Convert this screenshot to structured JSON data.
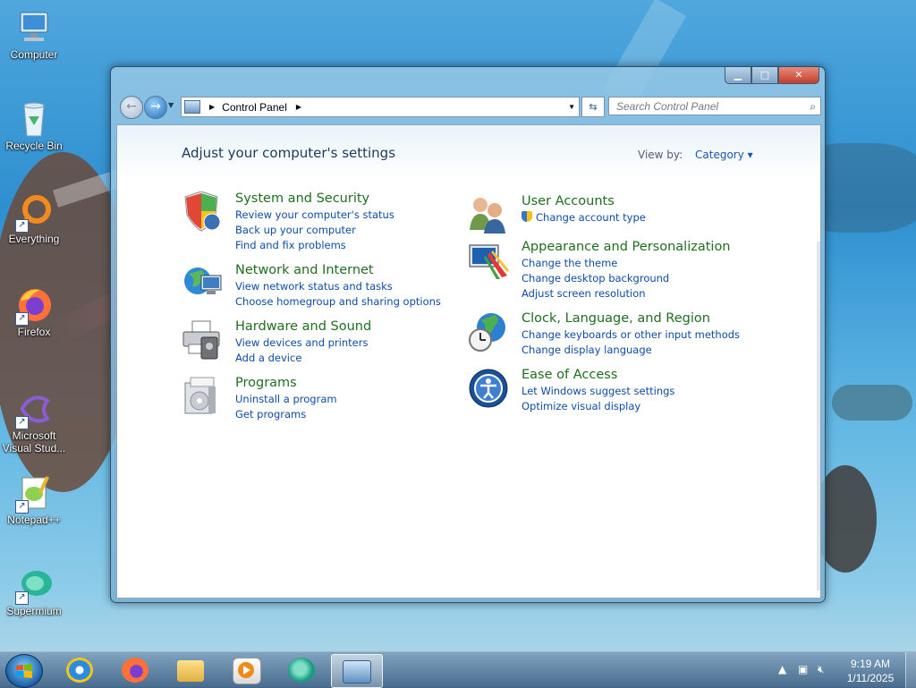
{
  "desktop": {
    "icons": [
      {
        "label": "Computer"
      },
      {
        "label": "Recycle Bin"
      },
      {
        "label": "Everything"
      },
      {
        "label": "Firefox"
      },
      {
        "label": "Microsoft Visual Stud..."
      },
      {
        "label": "Notepad++"
      },
      {
        "label": "Supermium"
      }
    ]
  },
  "window": {
    "address": {
      "crumb": "Control Panel",
      "icon": "control-panel-icon"
    },
    "search_placeholder": "Search Control Panel",
    "heading": "Adjust your computer's settings",
    "view_by_label": "View by:",
    "view_by_value": "Category",
    "categories_left": [
      {
        "title": "System and Security",
        "icon": "shield-icon",
        "links": [
          "Review your computer's status",
          "Back up your computer",
          "Find and fix problems"
        ]
      },
      {
        "title": "Network and Internet",
        "icon": "network-globe-icon",
        "links": [
          "View network status and tasks",
          "Choose homegroup and sharing options"
        ]
      },
      {
        "title": "Hardware and Sound",
        "icon": "printer-icon",
        "links": [
          "View devices and printers",
          "Add a device"
        ]
      },
      {
        "title": "Programs",
        "icon": "programs-icon",
        "links": [
          "Uninstall a program",
          "Get programs"
        ]
      }
    ],
    "categories_right": [
      {
        "title": "User Accounts",
        "icon": "users-icon",
        "links": [
          "Change account type"
        ]
      },
      {
        "title": "Appearance and Personalization",
        "icon": "monitor-palette-icon",
        "links": [
          "Change the theme",
          "Change desktop background",
          "Adjust screen resolution"
        ]
      },
      {
        "title": "Clock, Language, and Region",
        "icon": "globe-clock-icon",
        "links": [
          "Change keyboards or other input methods",
          "Change display language"
        ]
      },
      {
        "title": "Ease of Access",
        "icon": "ease-of-access-icon",
        "links": [
          "Let Windows suggest settings",
          "Optimize visual display"
        ]
      }
    ]
  },
  "taskbar": {
    "time": "9:19 AM",
    "date": "1/11/2025",
    "pinned": [
      "internet-explorer",
      "firefox",
      "file-explorer",
      "media-player",
      "supermium",
      "control-panel"
    ]
  }
}
